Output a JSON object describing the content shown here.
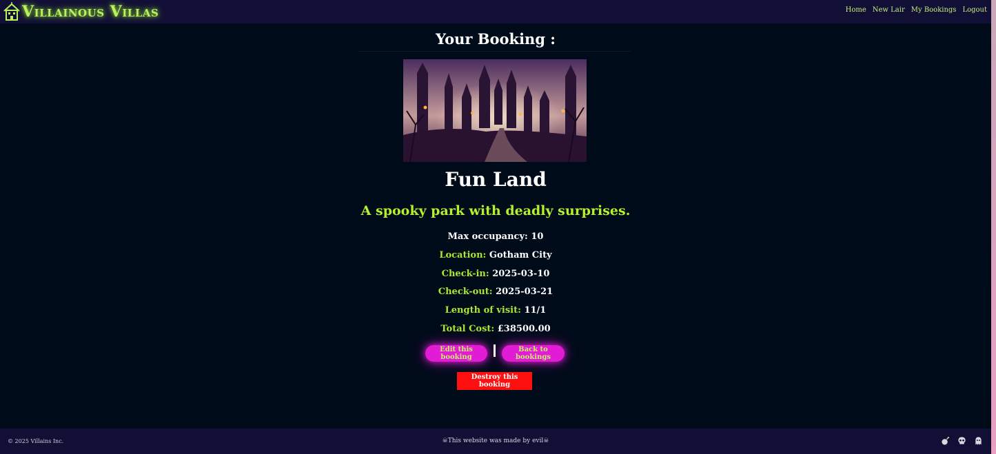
{
  "brand": {
    "name": "Villainous Villas",
    "icon": "haunted-house-icon"
  },
  "nav": {
    "home": "Home",
    "new_lair": "New Lair",
    "my_bookings": "My Bookings",
    "logout": "Logout"
  },
  "booking": {
    "heading": "Your Booking :",
    "image_alt": "spooky-castle-photo",
    "name": "Fun Land",
    "description": "A spooky park with deadly surprises.",
    "max_occupancy_label": "Max occupancy:",
    "max_occupancy": "10",
    "location_label": "Location:",
    "location": "Gotham City",
    "checkin_label": "Check-in:",
    "checkin": "2025-03-10",
    "checkout_label": "Check-out:",
    "checkout": "2025-03-21",
    "length_label": "Length of visit:",
    "length": "11/1",
    "total_label": "Total Cost:",
    "total": "£38500.00"
  },
  "actions": {
    "edit": "Edit this booking",
    "separator": "|",
    "back": "Back to bookings",
    "destroy": "Destroy this booking"
  },
  "footer": {
    "copyright": "© 2025 Villains Inc.",
    "made_by": "☠This website was made by evil☠",
    "icons": [
      "bomb-icon",
      "skull-icon",
      "ghost-icon"
    ]
  },
  "colors": {
    "background": "#000b1a",
    "navbar": "#120f36",
    "accent_green": "#b4f12e",
    "button_magenta": "#e21bd4",
    "destroy_red": "#ff1010"
  }
}
